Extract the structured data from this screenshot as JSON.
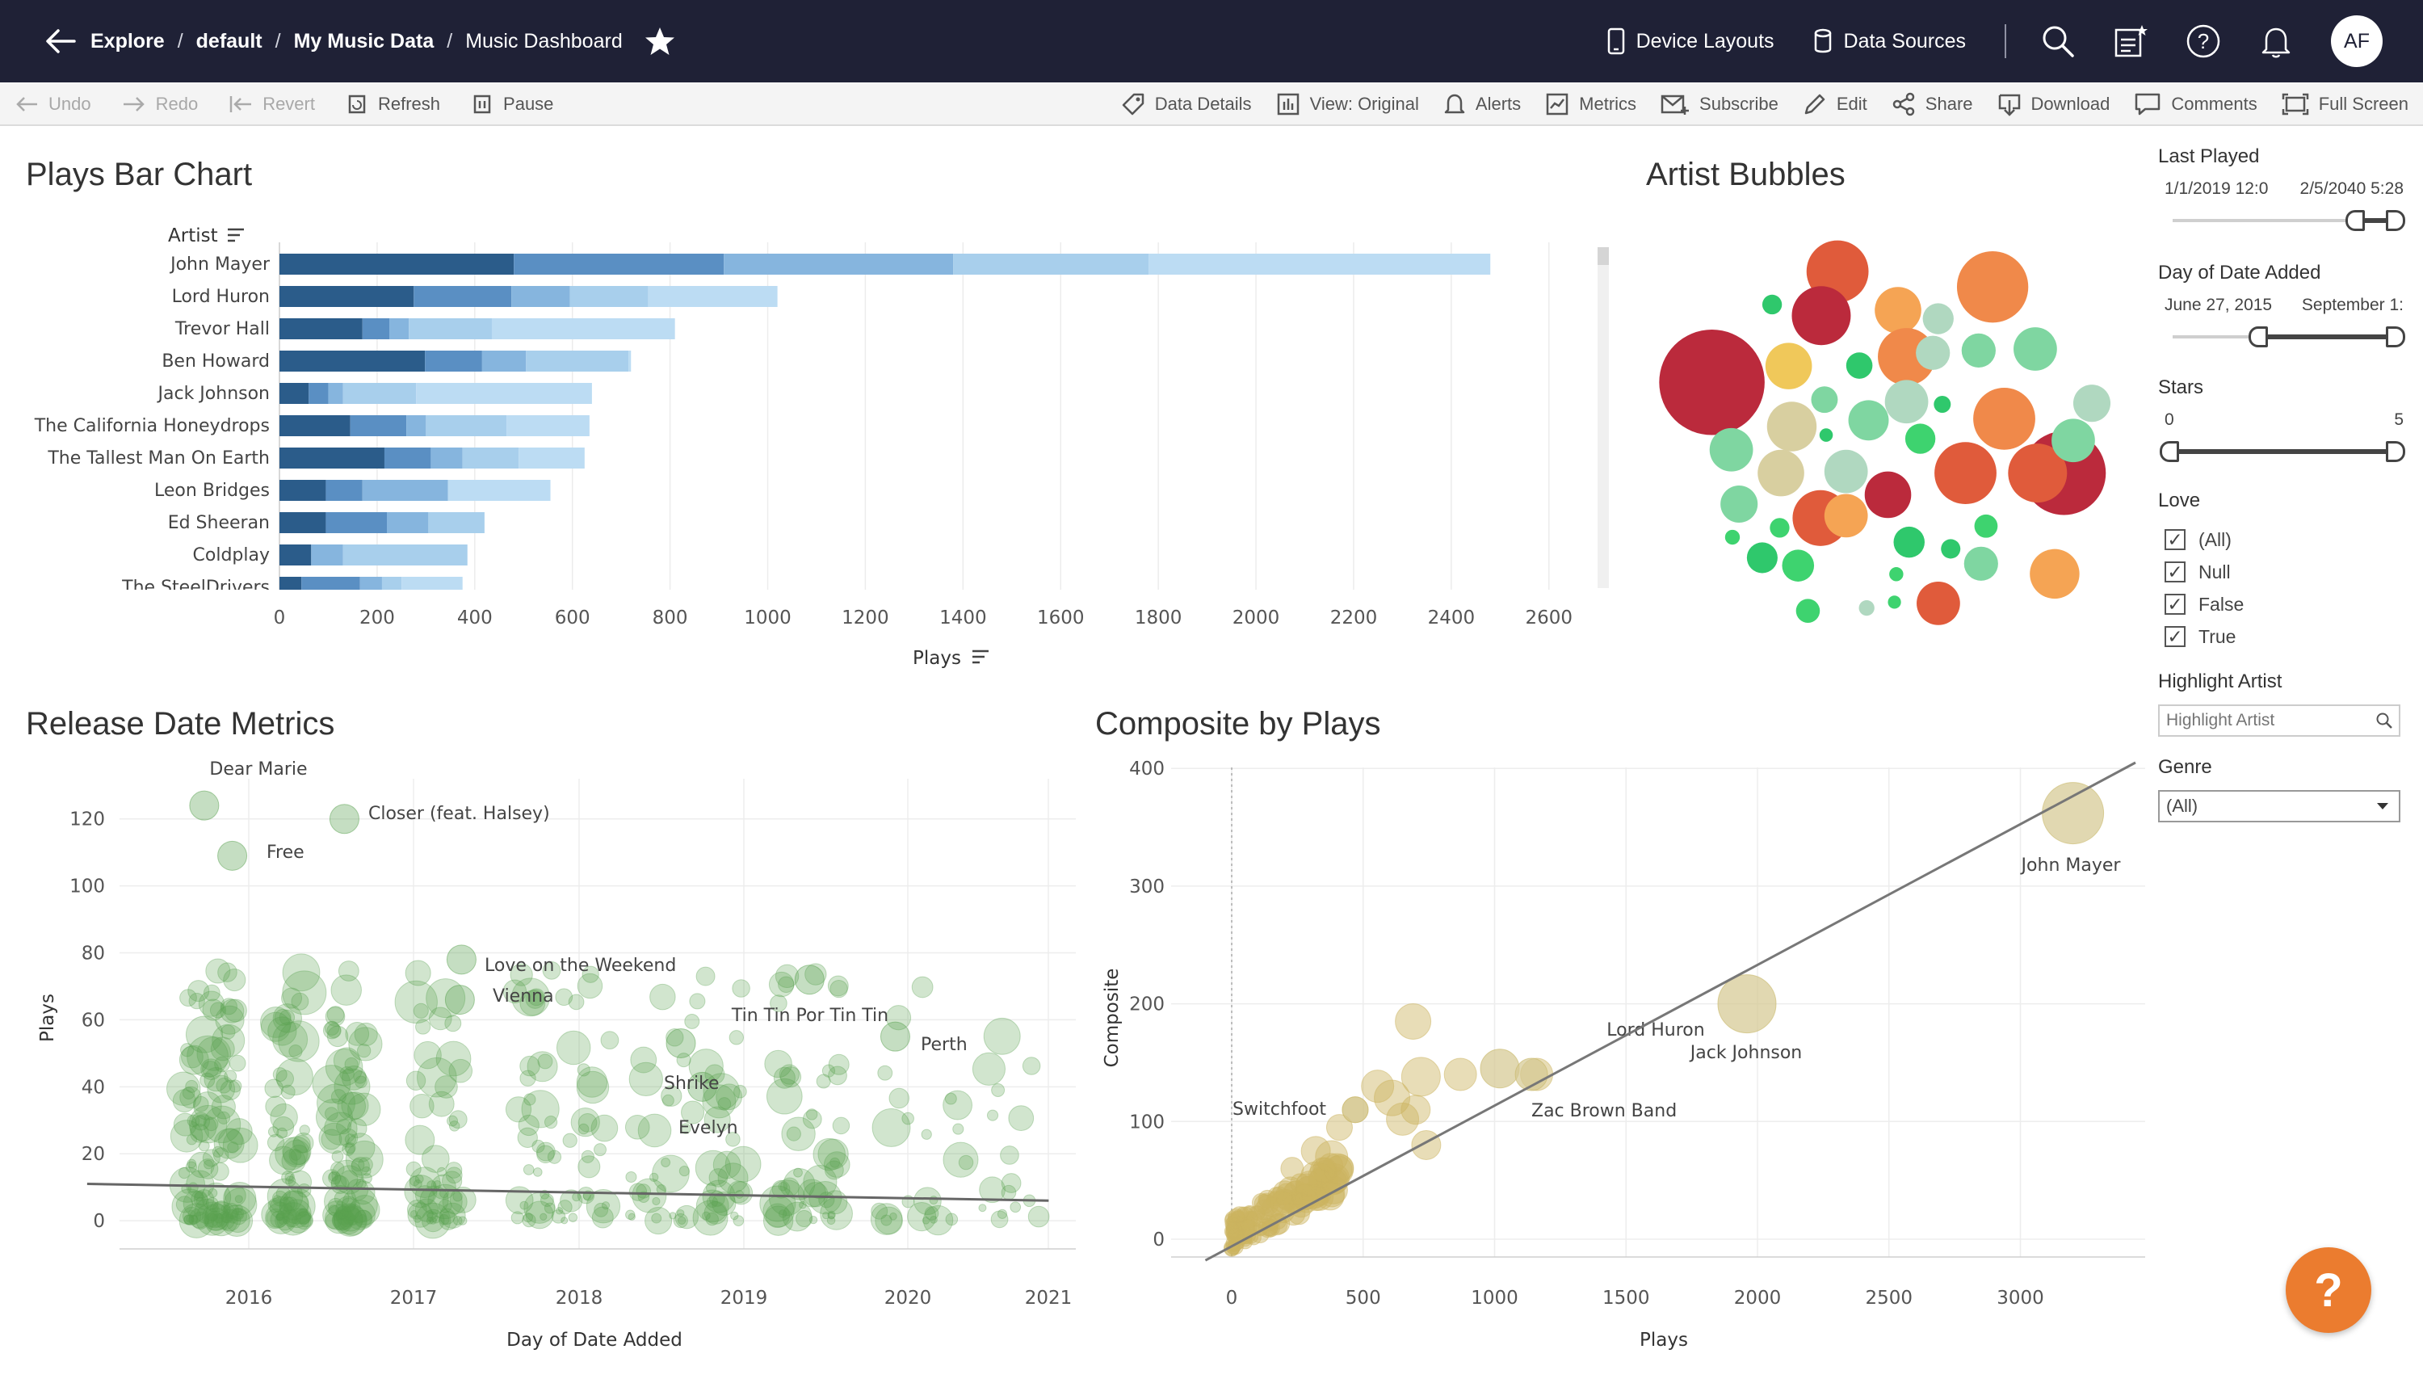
{
  "header": {
    "breadcrumbs": [
      "Explore",
      "default",
      "My Music Data",
      "Music Dashboard"
    ],
    "device_layouts": "Device Layouts",
    "data_sources": "Data Sources",
    "avatar_initials": "AF"
  },
  "toolbar": {
    "undo": "Undo",
    "redo": "Redo",
    "revert": "Revert",
    "refresh": "Refresh",
    "pause": "Pause",
    "data_details": "Data Details",
    "view": "View: Original",
    "alerts": "Alerts",
    "metrics": "Metrics",
    "subscribe": "Subscribe",
    "edit": "Edit",
    "share": "Share",
    "download": "Download",
    "comments": "Comments",
    "full_screen": "Full Screen"
  },
  "panels": {
    "bar_title": "Plays Bar Chart",
    "bubbles_title": "Artist Bubbles",
    "release_title": "Release Date Metrics",
    "composite_title": "Composite by Plays"
  },
  "filters": {
    "last_played": {
      "label": "Last Played",
      "from": "1/1/2019 12:0",
      "to": "2/5/2040 5:28"
    },
    "day_added": {
      "label": "Day of Date Added",
      "from": "June 27, 2015",
      "to": "September 1:"
    },
    "stars": {
      "label": "Stars",
      "from": "0",
      "to": "5"
    },
    "love": {
      "label": "Love",
      "options": [
        "(All)",
        "Null",
        "False",
        "True"
      ]
    },
    "highlight": {
      "label": "Highlight Artist",
      "placeholder": "Highlight Artist"
    },
    "genre": {
      "label": "Genre",
      "value": "(All)"
    }
  },
  "colors": {
    "header_bg": "#1f2136",
    "bar_segments": [
      "#2b5c8a",
      "#5a8fc3",
      "#86b5de",
      "#a8cfec",
      "#bcdcf3"
    ],
    "release_points": "#59a14f",
    "composite_points": "#d4c27a",
    "help_button": "#eb7c2f"
  },
  "chart_data": [
    {
      "type": "bar",
      "title": "Plays Bar Chart",
      "ylabel": "Artist",
      "xlabel": "Plays",
      "categories": [
        "John Mayer",
        "Lord Huron",
        "Trevor Hall",
        "Ben Howard",
        "Jack Johnson",
        "The California Honeydrops",
        "The Tallest Man On Earth",
        "Leon Bridges",
        "Ed Sheeran",
        "Coldplay",
        "The SteelDrivers"
      ],
      "stacked_values": [
        [
          480,
          430,
          470,
          400,
          700
        ],
        [
          275,
          200,
          120,
          160,
          265
        ],
        [
          170,
          55,
          40,
          170,
          375
        ],
        [
          298,
          117,
          90,
          210,
          5
        ],
        [
          60,
          40,
          30,
          150,
          360
        ],
        [
          145,
          115,
          40,
          165,
          170
        ],
        [
          215,
          95,
          65,
          115,
          135
        ],
        [
          95,
          75,
          175,
          0,
          210
        ],
        [
          95,
          125,
          85,
          115,
          0
        ],
        [
          65,
          0,
          65,
          255,
          0
        ],
        [
          45,
          120,
          45,
          40,
          125
        ]
      ],
      "xticks": [
        0,
        200,
        400,
        600,
        800,
        1000,
        1200,
        1400,
        1600,
        1800,
        2000,
        2200,
        2400,
        2600
      ],
      "xlim": [
        0,
        2650
      ]
    },
    {
      "type": "scatter",
      "title": "Release Date Metrics",
      "xlabel": "Day of Date Added",
      "ylabel": "Plays",
      "xticks": [
        "2016",
        "2017",
        "2018",
        "2019",
        "2020",
        "2021"
      ],
      "yticks": [
        0,
        20,
        40,
        60,
        80,
        100,
        120
      ],
      "ylim": [
        -6,
        132
      ],
      "labeled_points": [
        {
          "label": "Dear Marie",
          "x": 2015.73,
          "y": 124
        },
        {
          "label": "Closer (feat. Halsey)",
          "x": 2016.58,
          "y": 120
        },
        {
          "label": "Free",
          "x": 2015.9,
          "y": 109
        },
        {
          "label": "Love on the Weekend",
          "x": 2017.29,
          "y": 78
        },
        {
          "label": "Vienna",
          "x": 2017.28,
          "y": 66
        },
        {
          "label": "Tin Tin Por Tin Tin",
          "x": 2019.4,
          "y": 72
        },
        {
          "label": "Perth",
          "x": 2019.92,
          "y": 55
        },
        {
          "label": "Shrike",
          "x": 2018.62,
          "y": 53
        },
        {
          "label": "Evelyn",
          "x": 2018.75,
          "y": 40
        }
      ],
      "trend_line": [
        [
          2015.02,
          11
        ],
        [
          2020.85,
          6
        ]
      ]
    },
    {
      "type": "scatter",
      "title": "Composite by Plays",
      "xlabel": "Plays",
      "ylabel": "Composite",
      "xticks": [
        0,
        500,
        1000,
        1500,
        2000,
        2500,
        3000
      ],
      "yticks": [
        0,
        100,
        200,
        300,
        400
      ],
      "labeled_points": [
        {
          "label": "John Mayer",
          "x": 3200,
          "y": 362
        },
        {
          "label": "Jack Johnson",
          "x": 1960,
          "y": 200
        },
        {
          "label": "Lord Huron",
          "x": 1020,
          "y": 145
        },
        {
          "label": "Zac Brown Band",
          "x": 1140,
          "y": 140
        },
        {
          "label": "Switchfoot",
          "x": 470,
          "y": 110
        }
      ],
      "trend_line": [
        [
          -100,
          -18
        ],
        [
          3320,
          400
        ]
      ]
    },
    {
      "type": "scatter",
      "title": "Artist Bubbles",
      "note": "packed bubble chart sized by plays"
    }
  ]
}
